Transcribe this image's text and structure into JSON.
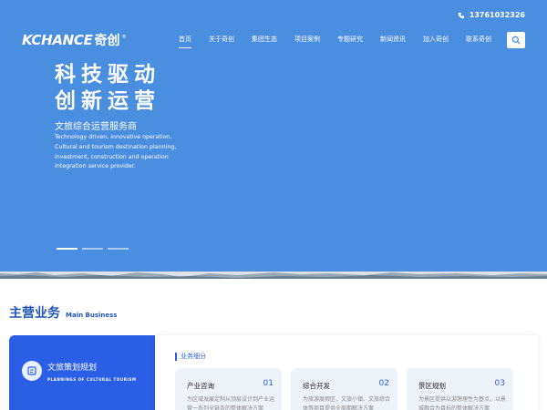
{
  "header": {
    "phone": "13761032326",
    "logo_en": "KCHANCE",
    "logo_cn": "奇创",
    "logo_mark": "®"
  },
  "nav": {
    "items": [
      {
        "label": "首页",
        "active": true
      },
      {
        "label": "关于奇创",
        "active": false
      },
      {
        "label": "集团生态",
        "active": false
      },
      {
        "label": "项目案例",
        "active": false
      },
      {
        "label": "专题研究",
        "active": false
      },
      {
        "label": "新闻资讯",
        "active": false
      },
      {
        "label": "加入奇创",
        "active": false
      },
      {
        "label": "联系奇创",
        "active": false
      }
    ]
  },
  "hero": {
    "line1": "科技驱动",
    "line2": "创新运营",
    "subtitle": "文旅综合运营服务商",
    "tagline": "Technology driven, innovative operation, Cultural and tourism destination planning, investment, construction and operation integration service provider.",
    "slides": 3,
    "active_slide": 0
  },
  "section": {
    "title_cn": "主营业务",
    "title_en": "Main Business"
  },
  "business": {
    "left_title": "文旅策划规划",
    "left_sub": "PLANNINGS OF CULTURAL TOURISM",
    "label": "业务细分",
    "items": [
      {
        "title": "产业咨询",
        "num": "01",
        "desc": "为区域发展定制从顶层设计到产业运营一系列全链条的整体解决方案"
      },
      {
        "title": "综合开发",
        "num": "02",
        "desc": "为旅游度假区、文旅小镇、文旅综合体等项目提供全周期解决方案"
      },
      {
        "title": "景区规划",
        "num": "03",
        "desc": "为景区提供以游憩理性为基点，以景城融合为目标的整体解决方案"
      }
    ]
  },
  "colors": {
    "hero_bg": "#4a8ee0",
    "accent": "#2a5fe5",
    "title": "#2156b8"
  }
}
